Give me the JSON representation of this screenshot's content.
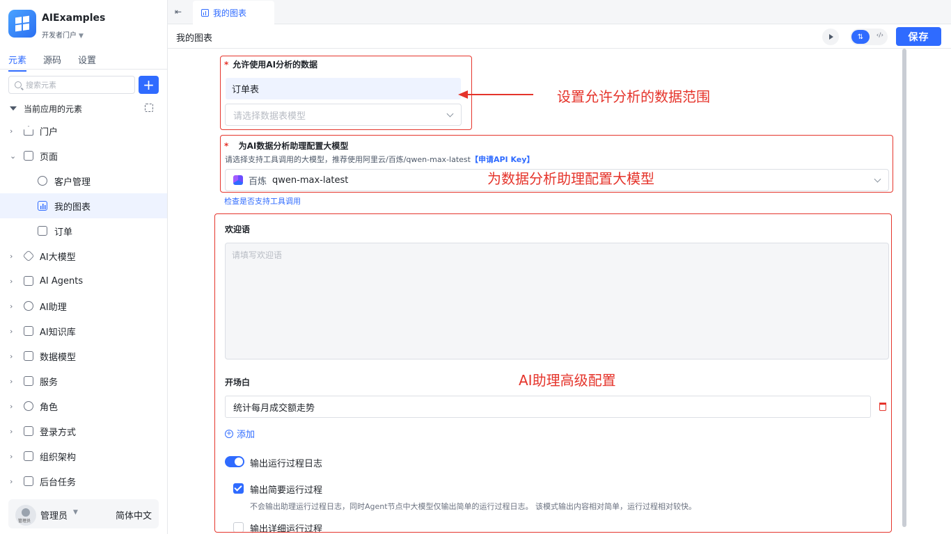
{
  "app": {
    "name": "AIExamples",
    "portal": "开发者门户"
  },
  "sidebar": {
    "tabs": [
      {
        "label": "元素"
      },
      {
        "label": "源码"
      },
      {
        "label": "设置"
      }
    ],
    "search_placeholder": "搜索元素",
    "add_label": "+",
    "section_title": "当前应用的元素",
    "items": [
      {
        "label": "门户"
      },
      {
        "label": "页面"
      },
      {
        "label": "客户管理"
      },
      {
        "label": "我的图表"
      },
      {
        "label": "订单"
      },
      {
        "label": "AI大模型"
      },
      {
        "label": "AI Agents"
      },
      {
        "label": "AI助理"
      },
      {
        "label": "AI知识库"
      },
      {
        "label": "数据模型"
      },
      {
        "label": "服务"
      },
      {
        "label": "角色"
      },
      {
        "label": "登录方式"
      },
      {
        "label": "组织架构"
      },
      {
        "label": "后台任务"
      }
    ],
    "user": {
      "avatar_tag": "管理员",
      "name": "管理员",
      "language": "简体中文"
    }
  },
  "tabbar": {
    "collapse_glyph": "⇤",
    "active_tab": "我的图表"
  },
  "header": {
    "title": "我的图表",
    "save_label": "保存",
    "mode_on_glyph": "⇅",
    "mode_off_glyph": "‹/›"
  },
  "form": {
    "data_label": "允许使用AI分析的数据",
    "data_selected": "订单表",
    "data_placeholder": "请选择数据表模型",
    "model_label": "为AI数据分析助理配置大模型",
    "model_hint": "请选择支持工具调用的大模型，推荐使用阿里云/百炼/qwen-max-latest",
    "model_hint_link": "【申请API Key】",
    "model_brand": "百炼",
    "model_name": "qwen-max-latest",
    "check_link": "检查是否支持工具调用",
    "welcome_label": "欢迎语",
    "welcome_placeholder": "请填写欢迎语",
    "opening_label": "开场白",
    "opening_value": "统计每月成交额走势",
    "add_label": "添加",
    "log_switch_label": "输出运行过程日志",
    "log_switch_on": true,
    "brief_label": "输出简要运行过程",
    "brief_checked": true,
    "brief_desc": "不会输出助理运行过程日志，同时Agent节点中大模型仅输出简单的运行过程日志。 该模式输出内容相对简单，运行过程相对较快。",
    "detail_label": "输出详细运行过程",
    "detail_checked": false
  },
  "annotations": {
    "data_range": "设置允许分析的数据范围",
    "model_config": "为数据分析助理配置大模型",
    "advanced": "AI助理高级配置"
  },
  "colors": {
    "accent": "#2f6bff",
    "annotation": "#e5342b"
  }
}
